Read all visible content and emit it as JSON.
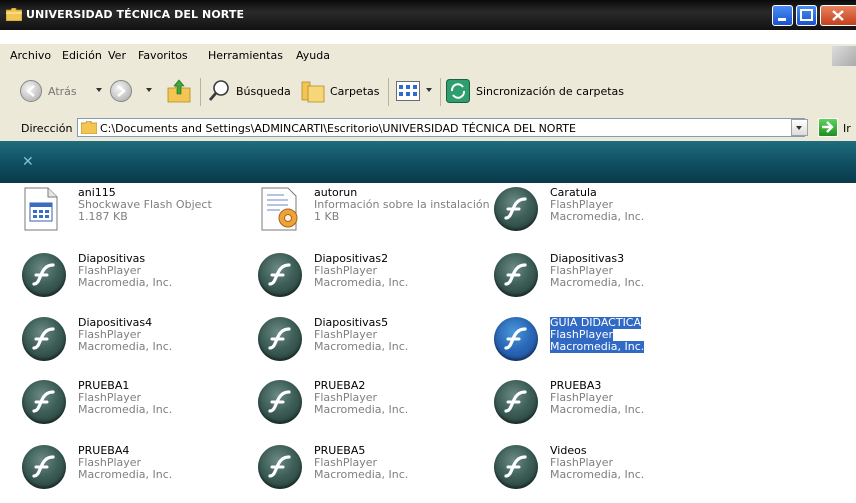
{
  "window": {
    "title": "UNIVERSIDAD TÉCNICA DEL NORTE"
  },
  "menu": [
    "Archivo",
    "Edición",
    "Ver",
    "Favoritos",
    "Herramientas",
    "Ayuda"
  ],
  "toolbar": {
    "back_label": "Atrás",
    "search_label": "Búsqueda",
    "folders_label": "Carpetas",
    "sync_label": "Sincronización de carpetas"
  },
  "address": {
    "label": "Dirección",
    "path": "C:\\Documents and Settings\\ADMINCARTI\\Escritorio\\UNIVERSIDAD TÉCNICA DEL NORTE",
    "go_label": "Ir"
  },
  "files": [
    {
      "name": "ani115",
      "line1": "Shockwave Flash Object",
      "line2": "1.187 KB",
      "icon": "flash-object-icon"
    },
    {
      "name": "autorun",
      "line1": "Información sobre la instalación",
      "line2": "1 KB",
      "icon": "setup-info-icon"
    },
    {
      "name": "Caratula",
      "line1": "FlashPlayer",
      "line2": "Macromedia, Inc.",
      "icon": "flashplayer-icon"
    },
    {
      "name": "Diapositivas",
      "line1": "FlashPlayer",
      "line2": "Macromedia, Inc.",
      "icon": "flashplayer-icon"
    },
    {
      "name": "Diapositivas2",
      "line1": "FlashPlayer",
      "line2": "Macromedia, Inc.",
      "icon": "flashplayer-icon"
    },
    {
      "name": "Diapositivas3",
      "line1": "FlashPlayer",
      "line2": "Macromedia, Inc.",
      "icon": "flashplayer-icon"
    },
    {
      "name": "Diapositivas4",
      "line1": "FlashPlayer",
      "line2": "Macromedia, Inc.",
      "icon": "flashplayer-icon"
    },
    {
      "name": "Diapositivas5",
      "line1": "FlashPlayer",
      "line2": "Macromedia, Inc.",
      "icon": "flashplayer-icon"
    },
    {
      "name": "GUIA DIDACTICA",
      "line1": "FlashPlayer",
      "line2": "Macromedia, Inc.",
      "icon": "flashplayer-icon",
      "selected": true
    },
    {
      "name": "PRUEBA1",
      "line1": "FlashPlayer",
      "line2": "Macromedia, Inc.",
      "icon": "flashplayer-icon"
    },
    {
      "name": "PRUEBA2",
      "line1": "FlashPlayer",
      "line2": "Macromedia, Inc.",
      "icon": "flashplayer-icon"
    },
    {
      "name": "PRUEBA3",
      "line1": "FlashPlayer",
      "line2": "Macromedia, Inc.",
      "icon": "flashplayer-icon"
    },
    {
      "name": "PRUEBA4",
      "line1": "FlashPlayer",
      "line2": "Macromedia, Inc.",
      "icon": "flashplayer-icon"
    },
    {
      "name": "PRUEBA5",
      "line1": "FlashPlayer",
      "line2": "Macromedia, Inc.",
      "icon": "flashplayer-icon"
    },
    {
      "name": "Videos",
      "line1": "FlashPlayer",
      "line2": "Macromedia, Inc.",
      "icon": "flashplayer-icon"
    }
  ],
  "colors": {
    "banner": "#0f4e61",
    "selection": "#316ac5",
    "chrome": "#ece9d8"
  }
}
